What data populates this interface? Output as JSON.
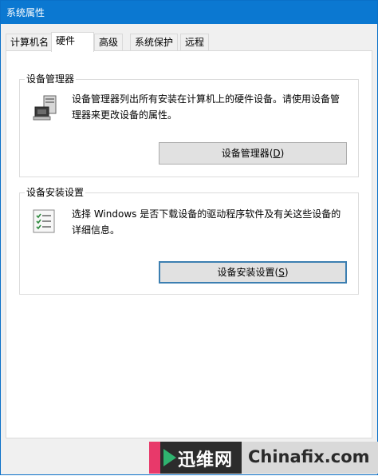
{
  "window": {
    "title": "系统属性"
  },
  "tabs": [
    {
      "label": "计算机名",
      "active": false
    },
    {
      "label": "硬件",
      "active": true
    },
    {
      "label": "高级",
      "active": false
    },
    {
      "label": "系统保护",
      "active": false
    },
    {
      "label": "远程",
      "active": false
    }
  ],
  "device_manager": {
    "group_title": "设备管理器",
    "description_line1": "设备管理器列出所有安装在计算机上的硬件设备。请使用设备管",
    "description_line2": "理器来更改设备的属性。",
    "button_label": "设备管理器(",
    "button_mnemonic": "D",
    "button_suffix": ")"
  },
  "device_install": {
    "group_title": "设备安装设置",
    "description_line1": "选择 Windows 是否下载设备的驱动程序软件及有关这些设备的",
    "description_line2": "详细信息。",
    "button_label": "设备安装设置(",
    "button_mnemonic": "S",
    "button_suffix": ")"
  },
  "watermark": {
    "chinese": "迅维网",
    "english": "Chinafix.com"
  },
  "icons": {
    "device_manager": "computer-device-icon",
    "device_install": "checklist-icon"
  },
  "colors": {
    "titlebar": "#0b78d1",
    "button_border_focus": "#3c7fb1",
    "watermark_pink": "#e8396a",
    "watermark_green": "#2fb36f"
  }
}
